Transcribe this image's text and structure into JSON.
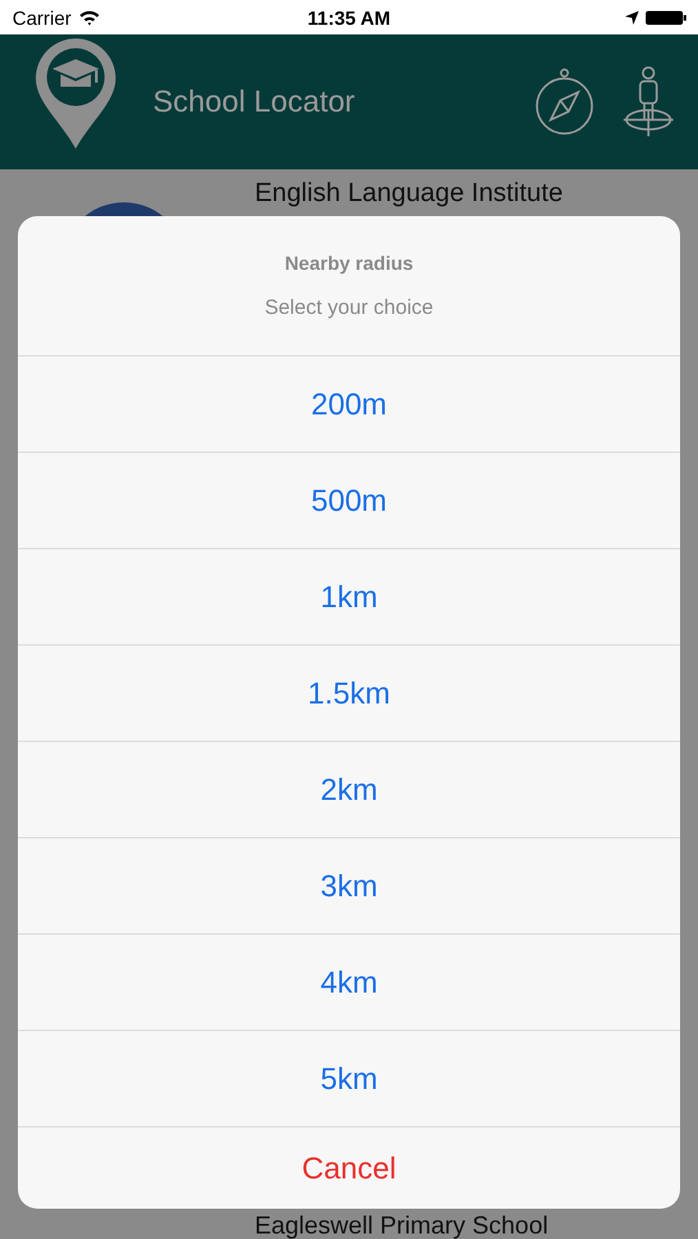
{
  "status_bar": {
    "carrier": "Carrier",
    "time": "11:35 AM"
  },
  "header": {
    "title": "School Locator"
  },
  "background_list": [
    {
      "title": "English Language Institute"
    },
    {
      "title": "Eagleswell Primary School"
    }
  ],
  "action_sheet": {
    "title": "Nearby radius",
    "message": "Select your choice",
    "options": [
      {
        "label": "200m",
        "kind": "default"
      },
      {
        "label": "500m",
        "kind": "default"
      },
      {
        "label": "1km",
        "kind": "default"
      },
      {
        "label": "1.5km",
        "kind": "default"
      },
      {
        "label": "2km",
        "kind": "default"
      },
      {
        "label": "3km",
        "kind": "default"
      },
      {
        "label": "4km",
        "kind": "default"
      },
      {
        "label": "5km",
        "kind": "default"
      },
      {
        "label": "Cancel",
        "kind": "cancel"
      }
    ]
  }
}
